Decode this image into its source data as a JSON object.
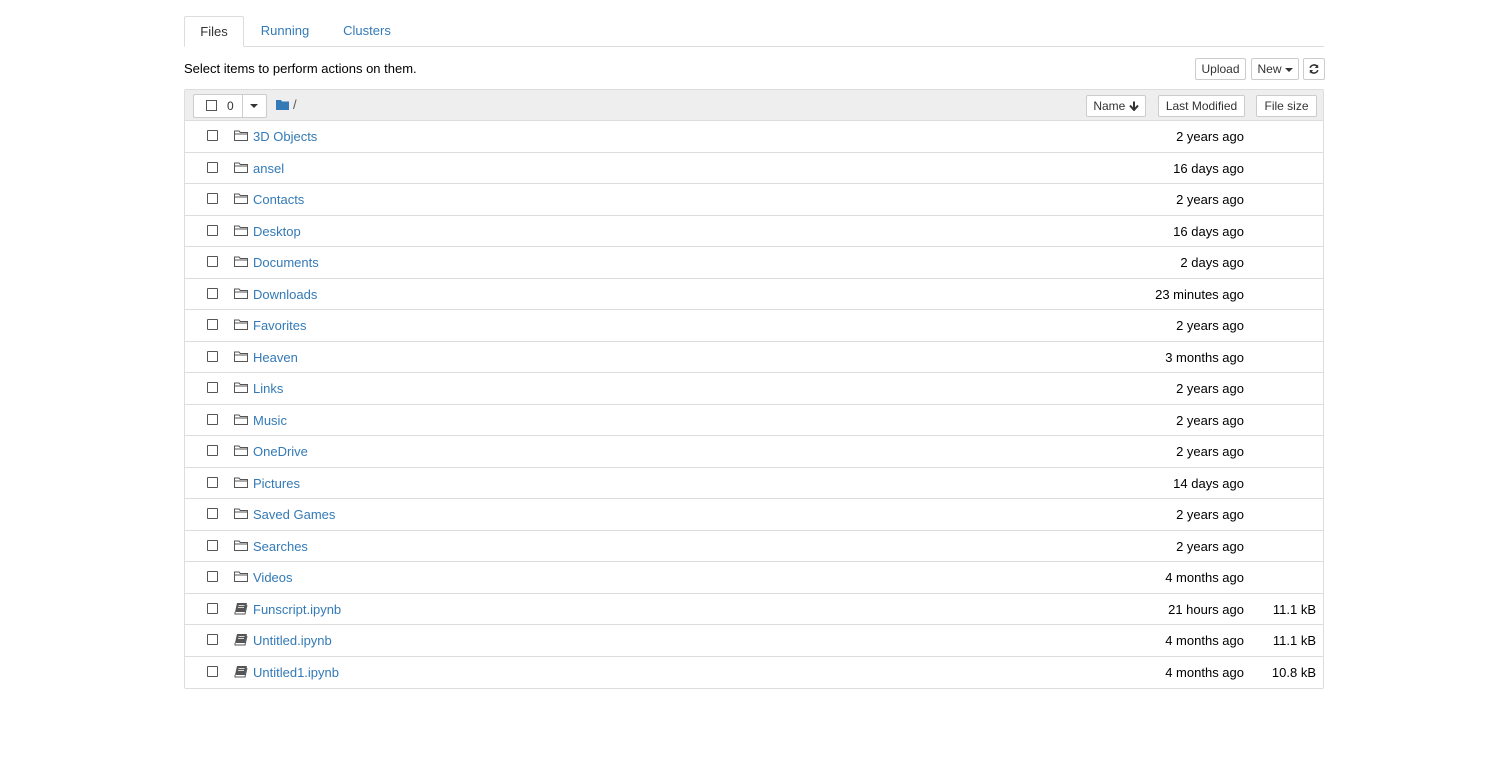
{
  "tabs": [
    {
      "label": "Files",
      "active": true
    },
    {
      "label": "Running",
      "active": false
    },
    {
      "label": "Clusters",
      "active": false
    }
  ],
  "toolbar": {
    "instructions": "Select items to perform actions on them.",
    "upload_label": "Upload",
    "new_label": "New",
    "refresh_icon": "refresh-icon"
  },
  "list_header": {
    "selected_count": "0",
    "breadcrumb_path": "/",
    "sort_name_label": "Name",
    "sort_modified_label": "Last Modified",
    "sort_size_label": "File size"
  },
  "colors": {
    "link": "#337ab7",
    "header_bg": "#eeeeee",
    "border": "#dddddd"
  },
  "items": [
    {
      "type": "folder",
      "name": "3D Objects",
      "modified": "2 years ago",
      "size": ""
    },
    {
      "type": "folder",
      "name": "ansel",
      "modified": "16 days ago",
      "size": ""
    },
    {
      "type": "folder",
      "name": "Contacts",
      "modified": "2 years ago",
      "size": ""
    },
    {
      "type": "folder",
      "name": "Desktop",
      "modified": "16 days ago",
      "size": ""
    },
    {
      "type": "folder",
      "name": "Documents",
      "modified": "2 days ago",
      "size": ""
    },
    {
      "type": "folder",
      "name": "Downloads",
      "modified": "23 minutes ago",
      "size": ""
    },
    {
      "type": "folder",
      "name": "Favorites",
      "modified": "2 years ago",
      "size": ""
    },
    {
      "type": "folder",
      "name": "Heaven",
      "modified": "3 months ago",
      "size": ""
    },
    {
      "type": "folder",
      "name": "Links",
      "modified": "2 years ago",
      "size": ""
    },
    {
      "type": "folder",
      "name": "Music",
      "modified": "2 years ago",
      "size": ""
    },
    {
      "type": "folder",
      "name": "OneDrive",
      "modified": "2 years ago",
      "size": ""
    },
    {
      "type": "folder",
      "name": "Pictures",
      "modified": "14 days ago",
      "size": ""
    },
    {
      "type": "folder",
      "name": "Saved Games",
      "modified": "2 years ago",
      "size": ""
    },
    {
      "type": "folder",
      "name": "Searches",
      "modified": "2 years ago",
      "size": ""
    },
    {
      "type": "folder",
      "name": "Videos",
      "modified": "4 months ago",
      "size": ""
    },
    {
      "type": "notebook",
      "name": "Funscript.ipynb",
      "modified": "21 hours ago",
      "size": "11.1 kB"
    },
    {
      "type": "notebook",
      "name": "Untitled.ipynb",
      "modified": "4 months ago",
      "size": "11.1 kB"
    },
    {
      "type": "notebook",
      "name": "Untitled1.ipynb",
      "modified": "4 months ago",
      "size": "10.8 kB"
    }
  ]
}
